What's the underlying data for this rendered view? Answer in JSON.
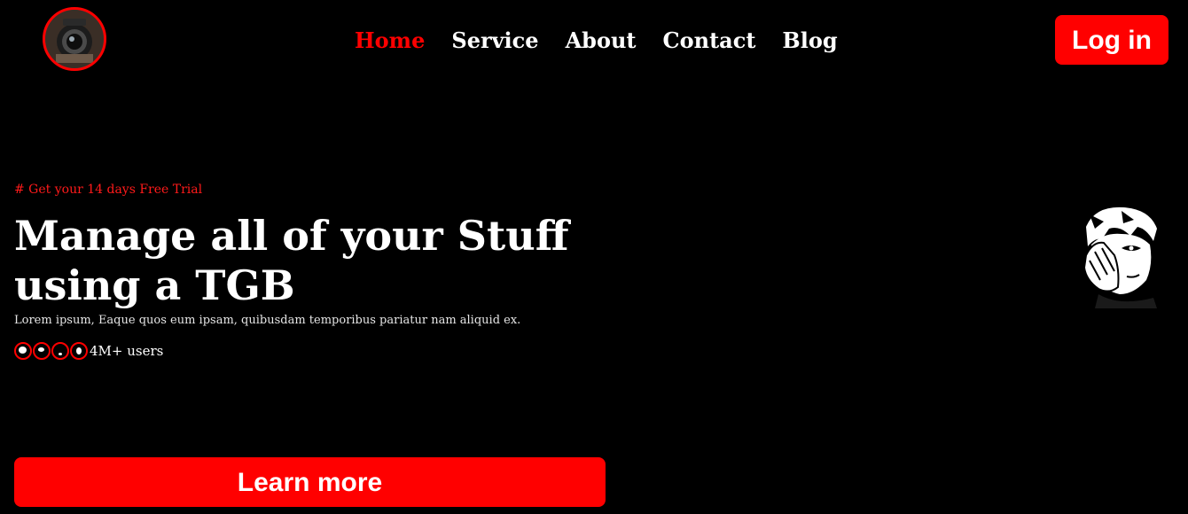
{
  "header": {
    "nav": [
      {
        "label": "Home",
        "active": true
      },
      {
        "label": "Service",
        "active": false
      },
      {
        "label": "About",
        "active": false
      },
      {
        "label": "Contact",
        "active": false
      },
      {
        "label": "Blog",
        "active": false
      }
    ],
    "login_label": "Log in"
  },
  "hero": {
    "trial_text": "# Get your 14 days Free Trial",
    "headline": "Manage all of your Stuff using a TGB",
    "description": "Lorem ipsum, Eaque quos eum ipsam, quibusdam temporibus pariatur nam aliquid ex.",
    "users_count": "4M+ users",
    "learn_more_label": "Learn more"
  },
  "colors": {
    "accent": "#ff0000",
    "background": "#000000",
    "text": "#ffffff"
  }
}
